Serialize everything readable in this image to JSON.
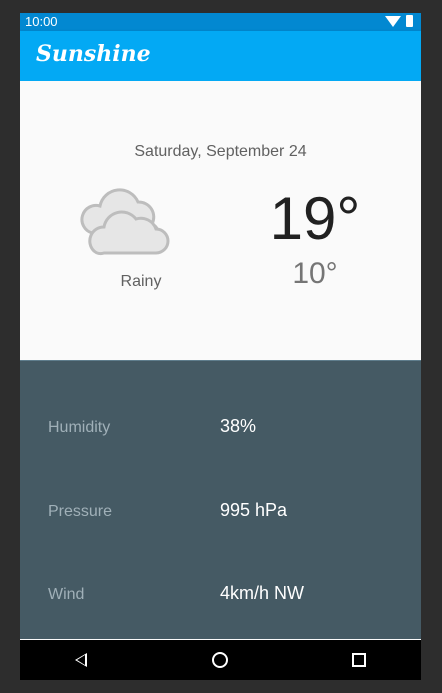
{
  "status_bar": {
    "time": "10:00",
    "wifi_icon": "wifi-icon",
    "battery_icon": "battery-icon"
  },
  "app_bar": {
    "title": "Sunshine"
  },
  "today": {
    "date": "Saturday, September 24",
    "icon": "cloud-icon",
    "description": "Rainy",
    "high": "19°",
    "low": "10°"
  },
  "details": {
    "humidity": {
      "label": "Humidity",
      "value": "38%"
    },
    "pressure": {
      "label": "Pressure",
      "value": "995 hPa"
    },
    "wind": {
      "label": "Wind",
      "value": "4km/h NW"
    }
  },
  "nav_bar": {
    "back_icon": "back-icon",
    "home_icon": "home-icon",
    "recents_icon": "recents-icon"
  },
  "colors": {
    "status_bar": "#0288d1",
    "app_bar": "#03a9f4",
    "details_bg": "#455a64",
    "nav_bar": "#000000"
  }
}
